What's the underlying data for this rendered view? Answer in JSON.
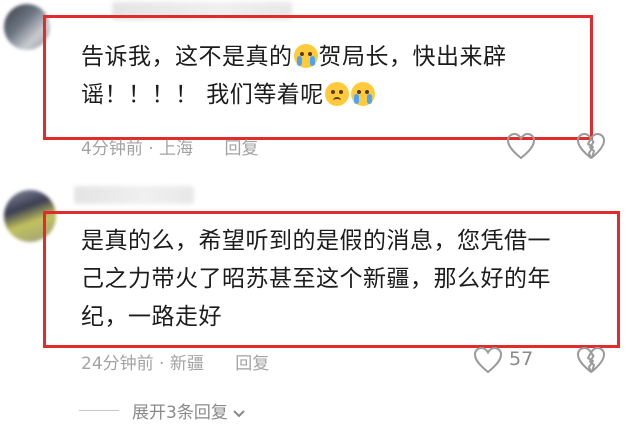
{
  "comments": [
    {
      "text_line1_a": "告诉我，这不是真的",
      "emoji_after_line1": "crying-emoji",
      "text_line1_b": "贺局长，快出来辟",
      "text_line2": "谣！！！！ 我们等着呢",
      "emojis_line2": [
        "confused-emoji",
        "crying-emoji"
      ],
      "time": "4分钟前",
      "separator": "·",
      "location": "上海",
      "reply_label": "回复"
    },
    {
      "text_line1": "是真的么，希望听到的是假的消息，您凭借一",
      "text_line2": "己之力带火了昭苏甚至这个新疆，那么好的年",
      "text_line3": "纪，一路走好",
      "time": "24分钟前",
      "separator": "·",
      "location": "新疆",
      "reply_label": "回复",
      "like_count": "57"
    }
  ],
  "expand_replies": "展开3条回复",
  "colors": {
    "highlight_box": "#e32b2b",
    "meta_text": "#a3a3a3"
  }
}
